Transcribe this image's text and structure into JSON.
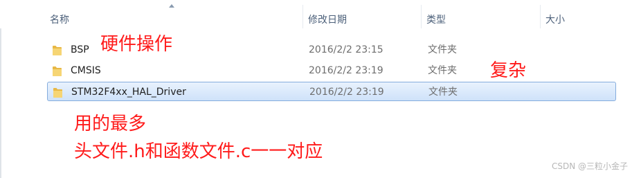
{
  "columns": {
    "name": "名称",
    "date": "修改日期",
    "type": "类型",
    "size": "大小"
  },
  "rows": [
    {
      "name": "BSP",
      "date": "2016/2/2 23:15",
      "type": "文件夹",
      "icon": "folder-icon",
      "selected": false
    },
    {
      "name": "CMSIS",
      "date": "2016/2/2 23:19",
      "type": "文件夹",
      "icon": "folder-icon",
      "selected": false
    },
    {
      "name": "STM32F4xx_HAL_Driver",
      "date": "2016/2/2 23:19",
      "type": "文件夹",
      "icon": "folder-icon",
      "selected": true
    }
  ],
  "annotations": {
    "bsp_note": "硬件操作",
    "cmsis_note": "复杂",
    "hal_note_line1": "用的最多",
    "hal_note_line2": "头文件.h和函数文件.c一一对应"
  },
  "watermark": "CSDN @三粒小金子",
  "colors": {
    "annotation": "#ff1a1a",
    "selection_border": "#84acdd",
    "header_text": "#4c607a",
    "folder": "#e8b845"
  }
}
